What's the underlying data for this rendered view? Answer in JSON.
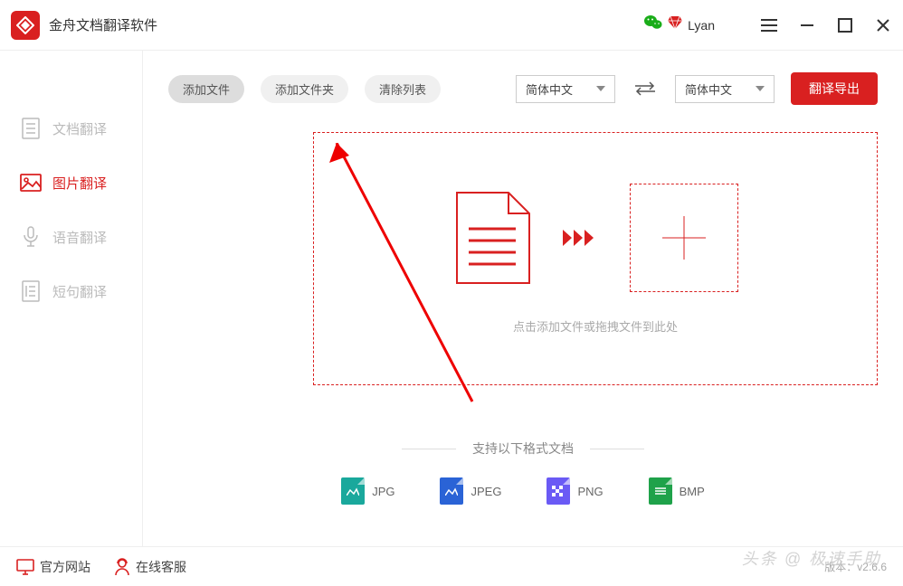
{
  "app": {
    "title": "金舟文档翻译软件"
  },
  "user": {
    "name": "Lyan"
  },
  "sidebar": {
    "items": [
      {
        "label": "文档翻译",
        "icon": "document-icon"
      },
      {
        "label": "图片翻译",
        "icon": "image-icon"
      },
      {
        "label": "语音翻译",
        "icon": "audio-icon"
      },
      {
        "label": "短句翻译",
        "icon": "sentence-icon"
      }
    ],
    "active_index": 1
  },
  "toolbar": {
    "add_file": "添加文件",
    "add_folder": "添加文件夹",
    "clear_list": "清除列表",
    "lang_from": "简体中文",
    "lang_to": "简体中文",
    "export": "翻译导出"
  },
  "dropzone": {
    "hint": "点击添加文件或拖拽文件到此处"
  },
  "formats": {
    "title": "支持以下格式文档",
    "items": [
      {
        "label": "JPG",
        "color": "#1aa89c"
      },
      {
        "label": "JPEG",
        "color": "#2a63d6"
      },
      {
        "label": "PNG",
        "color": "#6a5af5"
      },
      {
        "label": "BMP",
        "color": "#1fa24a"
      }
    ]
  },
  "footer": {
    "official_site": "官方网站",
    "online_support": "在线客服",
    "version_label": "版本：v2.6.6"
  },
  "watermark": "头条 @ 极速手助"
}
